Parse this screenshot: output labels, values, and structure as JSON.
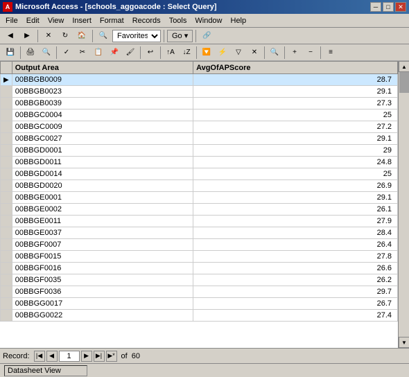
{
  "titlebar": {
    "title": "Microsoft Access - [schools_aggoacode : Select Query]",
    "icon": "A",
    "min_btn": "─",
    "max_btn": "□",
    "close_btn": "✕",
    "app_min": "─",
    "app_max": "□",
    "app_close": "✕"
  },
  "menu": {
    "items": [
      "File",
      "Edit",
      "View",
      "Insert",
      "Format",
      "Records",
      "Tools",
      "Window",
      "Help"
    ]
  },
  "toolbar1": {
    "go_text": "Go ▾",
    "favorites_text": "Favorites ▾"
  },
  "table": {
    "headers": [
      "Output Area",
      "AvgOfAPScore"
    ],
    "rows": [
      {
        "area": "00BBGB0009",
        "score": "28.7"
      },
      {
        "area": "00BBGB0023",
        "score": "29.1"
      },
      {
        "area": "00BBGB0039",
        "score": "27.3"
      },
      {
        "area": "00BBGC0004",
        "score": "25"
      },
      {
        "area": "00BBGC0009",
        "score": "27.2"
      },
      {
        "area": "00BBGC0027",
        "score": "29.1"
      },
      {
        "area": "00BBGD0001",
        "score": "29"
      },
      {
        "area": "00BBGD0011",
        "score": "24.8"
      },
      {
        "area": "00BBGD0014",
        "score": "25"
      },
      {
        "area": "00BBGD0020",
        "score": "26.9"
      },
      {
        "area": "00BBGE0001",
        "score": "29.1"
      },
      {
        "area": "00BBGE0002",
        "score": "26.1"
      },
      {
        "area": "00BBGE0011",
        "score": "27.9"
      },
      {
        "area": "00BBGE0037",
        "score": "28.4"
      },
      {
        "area": "00BBGF0007",
        "score": "26.4"
      },
      {
        "area": "00BBGF0015",
        "score": "27.8"
      },
      {
        "area": "00BBGF0016",
        "score": "26.6"
      },
      {
        "area": "00BBGF0035",
        "score": "26.2"
      },
      {
        "area": "00BBGF0036",
        "score": "29.7"
      },
      {
        "area": "00BBGG0017",
        "score": "26.7"
      },
      {
        "area": "00BBGG0022",
        "score": "27.4"
      }
    ]
  },
  "record_nav": {
    "label": "Record:",
    "current": "1",
    "total": "60"
  },
  "status": {
    "text": "Datasheet View"
  }
}
